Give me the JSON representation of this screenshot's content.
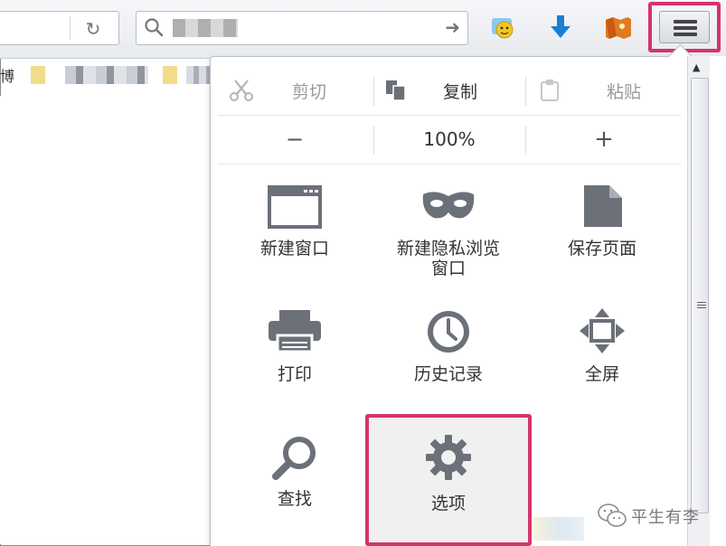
{
  "toolbar": {
    "reload_icon": "reload-icon",
    "search_placeholder": "",
    "go_icon": "go-arrow-icon",
    "menu_icon": "hamburger-menu-icon"
  },
  "bookmarks": {
    "partial_text": "博"
  },
  "panel": {
    "edit": {
      "cut": "剪切",
      "copy": "复制",
      "paste": "粘贴"
    },
    "zoom": {
      "minus": "−",
      "level": "100%",
      "plus": "+"
    },
    "tiles": [
      {
        "label": "新建窗口",
        "icon": "window-icon"
      },
      {
        "label": "新建隐私浏览\n窗口",
        "icon": "mask-icon"
      },
      {
        "label": "保存页面",
        "icon": "page-icon"
      },
      {
        "label": "打印",
        "icon": "printer-icon"
      },
      {
        "label": "历史记录",
        "icon": "clock-icon"
      },
      {
        "label": "全屏",
        "icon": "fullscreen-icon"
      },
      {
        "label": "查找",
        "icon": "magnifier-icon"
      },
      {
        "label": "选项",
        "icon": "gear-icon"
      }
    ]
  },
  "watermark": {
    "text": "平生有李"
  },
  "colors": {
    "highlight": "#d6336c",
    "icon_gray": "#6b7079",
    "download_blue": "#1a7fd4"
  }
}
